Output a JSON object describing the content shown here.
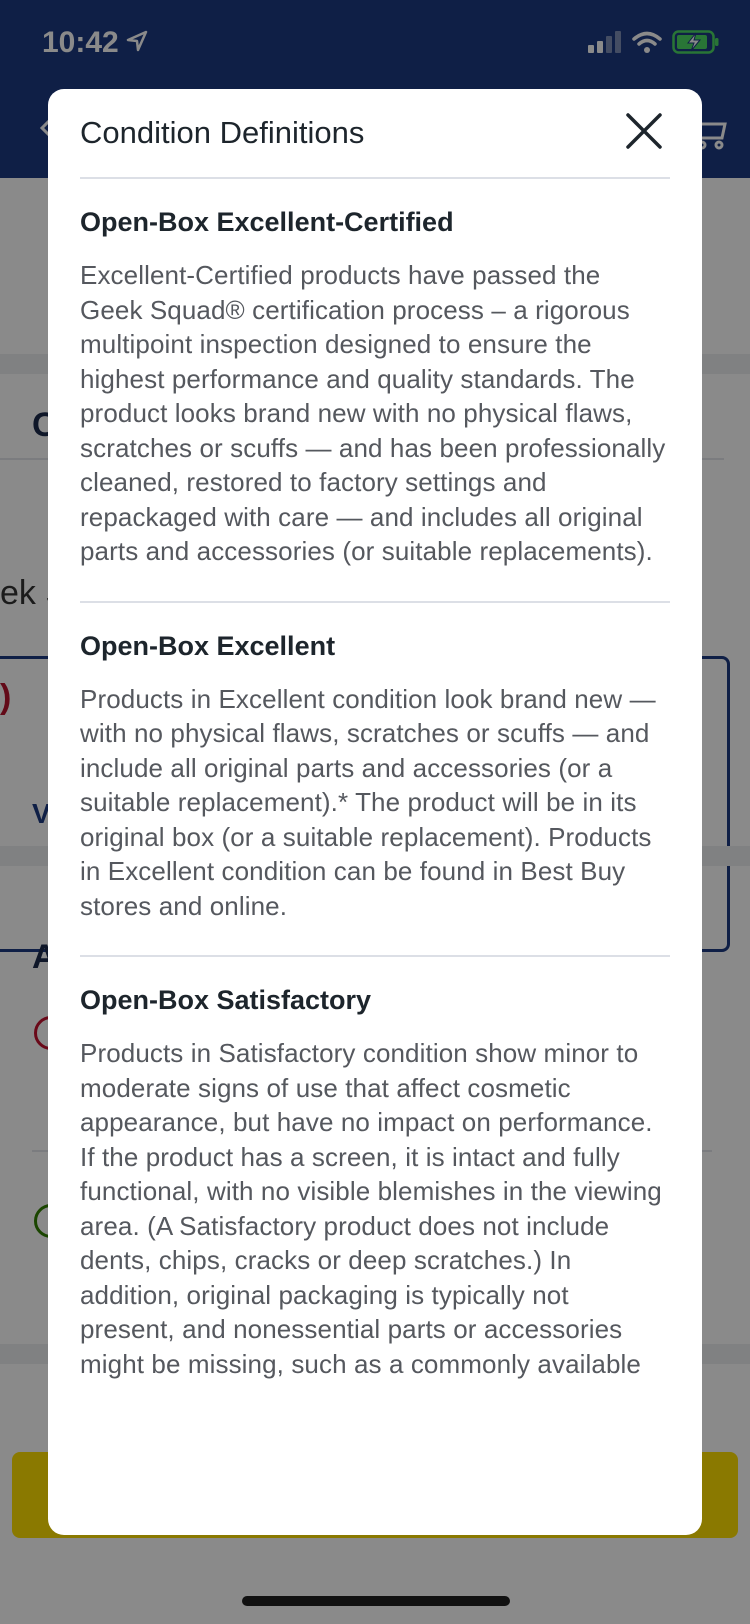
{
  "status_bar": {
    "time": "10:42"
  },
  "background": {
    "partial_texts": [
      "C",
      "ek S",
      ")",
      "V",
      "A"
    ]
  },
  "modal": {
    "title": "Condition Definitions",
    "sections": [
      {
        "title": "Open-Box Excellent-Certified",
        "body": "Excellent-Certified products have passed the Geek Squad® certification process – a rigorous multipoint inspection designed to ensure the highest performance and quality standards.  The product looks brand new with no physical flaws, scratches or scuffs — and has been professionally cleaned, restored to factory settings and repackaged with care — and includes all original parts and accessories (or suitable replacements)."
      },
      {
        "title": "Open-Box Excellent",
        "body": "Products in Excellent condition look brand new — with no physical flaws, scratches or scuffs — and include all original parts and accessories (or a suitable replacement).* The product will be in its original box (or a suitable replacement). Products in Excellent condition can be found in Best Buy stores and online."
      },
      {
        "title": "Open-Box Satisfactory",
        "body": "Products in Satisfactory condition show minor to moderate signs of use that affect cosmetic appearance, but have no impact on performance. If the product has a screen, it is intact and fully functional, with no visible blemishes in the viewing area. (A Satisfactory product does not include dents, chips, cracks or deep scratches.) In addition, original packaging is typically not present, and nonessential parts or accessories might be missing, such as a commonly available"
      }
    ]
  },
  "colors": {
    "header_blue": "#1d3a82",
    "yellow_button": "#ffe000",
    "modal_bg": "#ffffff"
  }
}
